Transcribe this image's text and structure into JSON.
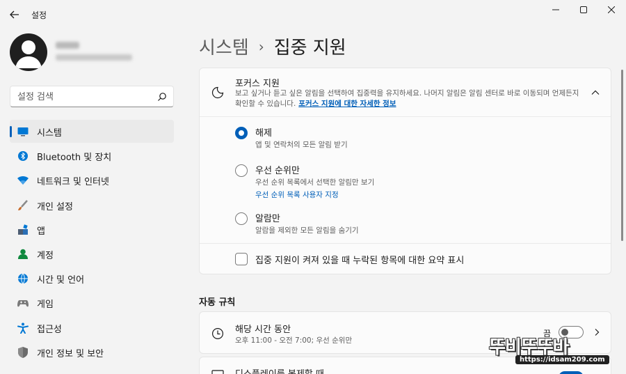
{
  "window": {
    "app_title": "설정",
    "back_icon": "back-arrow-icon",
    "controls": [
      "minimize-icon",
      "maximize-icon",
      "close-icon"
    ]
  },
  "sidebar": {
    "search": {
      "placeholder": "설정 검색",
      "icon": "search-icon"
    },
    "items": [
      {
        "label": "시스템",
        "icon": "system-icon",
        "active": true,
        "color": "#0078d4"
      },
      {
        "label": "Bluetooth 및 장치",
        "icon": "bluetooth-icon",
        "active": false,
        "color": "#0078d4"
      },
      {
        "label": "네트워크 및 인터넷",
        "icon": "wifi-icon",
        "active": false,
        "color": "#0078d4"
      },
      {
        "label": "개인 설정",
        "icon": "brush-icon",
        "active": false,
        "color": "#c86b2a"
      },
      {
        "label": "앱",
        "icon": "apps-icon",
        "active": false,
        "color": "#4c5d73"
      },
      {
        "label": "계정",
        "icon": "account-icon",
        "active": false,
        "color": "#10893e"
      },
      {
        "label": "시간 및 언어",
        "icon": "globe-icon",
        "active": false,
        "color": "#0078d4"
      },
      {
        "label": "게임",
        "icon": "gamepad-icon",
        "active": false,
        "color": "#7a7a7a"
      },
      {
        "label": "접근성",
        "icon": "accessibility-icon",
        "active": false,
        "color": "#0078d4"
      },
      {
        "label": "개인 정보 및 보안",
        "icon": "shield-icon",
        "active": false,
        "color": "#6b6b6b"
      }
    ]
  },
  "main": {
    "breadcrumb": {
      "parent": "시스템",
      "separator": "›",
      "current": "집중 지원"
    },
    "focus": {
      "title": "포커스 지원",
      "description": "보고 싶거나 듣고 싶은 알림을 선택하여 집중력을 유지하세요. 나머지 알림은 알림 센터로 바로 이동되며 언제든지 확인할 수 있습니다.",
      "link": "포커스 지원에 대한 자세한 정보",
      "options": [
        {
          "title": "해제",
          "subtitle": "앱 및 연락처의 모든 알림 받기",
          "checked": true
        },
        {
          "title": "우선 순위만",
          "subtitle": "우선 순위 목록에서 선택한 알림만 보기",
          "link": "우선 순위 목록 사용자 지정",
          "checked": false
        },
        {
          "title": "알람만",
          "subtitle": "알람을 제외한 모든 알림을 숨기기",
          "checked": false
        }
      ],
      "summary_label": "집중 지원이 켜져 있을 때 누락된 항목에 대한 요약 표시",
      "summary_checked": false
    },
    "auto_rules": {
      "section_title": "자동 규칙",
      "rules": [
        {
          "title": "해당 시간 동안",
          "subtitle": "오후 11:00 - 오전 7:00; 우선 순위만",
          "toggle_label": "끔",
          "toggle_on": false
        },
        {
          "title": "디스플레이를 복제할 때",
          "toggle_on": true
        }
      ]
    }
  },
  "watermark": {
    "text": "뚜비뚜뚜바",
    "url": "https://idsam209.com"
  },
  "colors": {
    "accent": "#005fb8",
    "background": "#f3f3f3",
    "card": "#fbfbfb"
  }
}
